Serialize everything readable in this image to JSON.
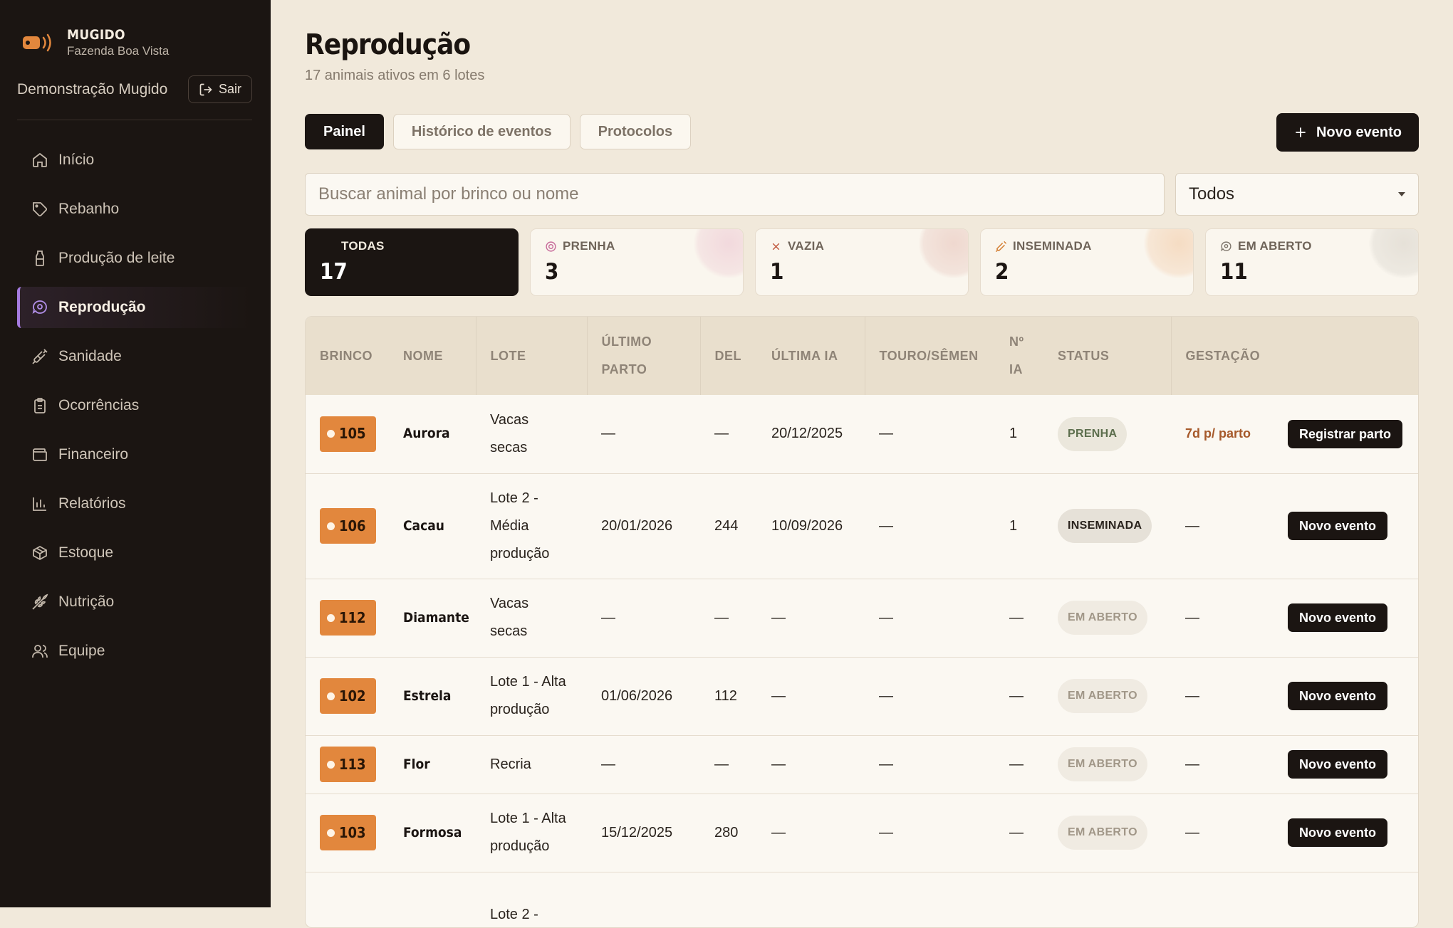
{
  "sidebar": {
    "brand_name": "MUGIDO",
    "farm_name": "Fazenda Boa Vista",
    "user_name": "Demonstração Mugido",
    "logout_label": "Sair",
    "items": [
      {
        "label": "Início",
        "icon": "home-icon"
      },
      {
        "label": "Rebanho",
        "icon": "tag-icon"
      },
      {
        "label": "Produção de leite",
        "icon": "milk-bottle-icon"
      },
      {
        "label": "Reprodução",
        "icon": "reproduction-icon",
        "active": true
      },
      {
        "label": "Sanidade",
        "icon": "syringe-icon"
      },
      {
        "label": "Ocorrências",
        "icon": "clipboard-icon"
      },
      {
        "label": "Financeiro",
        "icon": "wallet-icon"
      },
      {
        "label": "Relatórios",
        "icon": "bar-chart-icon"
      },
      {
        "label": "Estoque",
        "icon": "package-icon"
      },
      {
        "label": "Nutrição",
        "icon": "wheat-icon"
      },
      {
        "label": "Equipe",
        "icon": "users-icon"
      }
    ]
  },
  "header": {
    "title": "Reprodução",
    "subtitle": "17 animais ativos em 6 lotes"
  },
  "tabs": [
    {
      "label": "Painel",
      "active": true
    },
    {
      "label": "Histórico de eventos"
    },
    {
      "label": "Protocolos"
    }
  ],
  "new_event_label": "Novo evento",
  "search": {
    "placeholder": "Buscar animal por brinco ou nome"
  },
  "filter": {
    "selected": "Todos"
  },
  "summary_cards": [
    {
      "label": "TODAS",
      "count": "17"
    },
    {
      "label": "PRENHA",
      "count": "3",
      "icon": "pregnant-icon"
    },
    {
      "label": "VAZIA",
      "count": "1",
      "icon": "x-icon"
    },
    {
      "label": "INSEMINADA",
      "count": "2",
      "icon": "syringe-icon"
    },
    {
      "label": "EM ABERTO",
      "count": "11",
      "icon": "reproduction-icon"
    }
  ],
  "table": {
    "columns": [
      "BRINCO",
      "NOME",
      "LOTE",
      "ÚLTIMO PARTO",
      "DEL",
      "ÚLTIMA IA",
      "TOURO/SÊMEN",
      "Nº IA",
      "STATUS",
      "GESTAÇÃO",
      ""
    ],
    "rows": [
      {
        "brinco": "105",
        "nome": "Aurora",
        "lote": "Vacas secas",
        "ultimo_parto": "—",
        "del": "—",
        "ultima_ia": "20/12/2025",
        "touro": "—",
        "n_ia": "1",
        "status": "PRENHA",
        "gestacao": "7d p/ parto",
        "action": "Registrar parto"
      },
      {
        "brinco": "106",
        "nome": "Cacau",
        "lote": "Lote 2 - Média produção",
        "ultimo_parto": "20/01/2026",
        "del": "244",
        "ultima_ia": "10/09/2026",
        "touro": "—",
        "n_ia": "1",
        "status": "INSEMINADA",
        "gestacao": "—",
        "action": "Novo evento"
      },
      {
        "brinco": "112",
        "nome": "Diamante",
        "lote": "Vacas secas",
        "ultimo_parto": "—",
        "del": "—",
        "ultima_ia": "—",
        "touro": "—",
        "n_ia": "—",
        "status": "EM ABERTO",
        "gestacao": "—",
        "action": "Novo evento"
      },
      {
        "brinco": "102",
        "nome": "Estrela",
        "lote": "Lote 1 - Alta produção",
        "ultimo_parto": "01/06/2026",
        "del": "112",
        "ultima_ia": "—",
        "touro": "—",
        "n_ia": "—",
        "status": "EM ABERTO",
        "gestacao": "—",
        "action": "Novo evento"
      },
      {
        "brinco": "113",
        "nome": "Flor",
        "lote": "Recria",
        "ultimo_parto": "—",
        "del": "—",
        "ultima_ia": "—",
        "touro": "—",
        "n_ia": "—",
        "status": "EM ABERTO",
        "gestacao": "—",
        "action": "Novo evento"
      },
      {
        "brinco": "103",
        "nome": "Formosa",
        "lote": "Lote 1 - Alta produção",
        "ultimo_parto": "15/12/2025",
        "del": "280",
        "ultima_ia": "—",
        "touro": "—",
        "n_ia": "—",
        "status": "EM ABERTO",
        "gestacao": "—",
        "action": "Novo evento"
      },
      {
        "brinco": "",
        "nome": "",
        "lote": "Lote 2 -",
        "ultimo_parto": "",
        "del": "",
        "ultima_ia": "",
        "touro": "",
        "n_ia": "",
        "status": "",
        "gestacao": "",
        "action": ""
      }
    ]
  }
}
